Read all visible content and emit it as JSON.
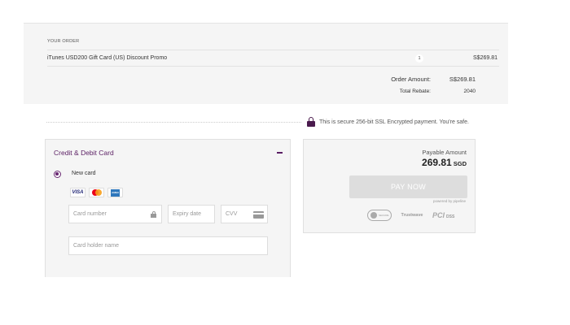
{
  "order": {
    "heading": "YOUR ORDER",
    "item_name": "iTunes USD200 Gift Card (US) Discount Promo",
    "item_qty": "1",
    "item_price": "S$269.81",
    "order_amount_label": "Order Amount:",
    "order_amount_value": "S$269.81",
    "rebate_label": "Total Rebate:",
    "rebate_value": "2040"
  },
  "secure": {
    "text": "This is secure 256-bit SSL Encrypted payment. You're safe."
  },
  "card_form": {
    "title": "Credit & Debit Card",
    "new_card_label": "New card",
    "brands": [
      "VISA",
      "mastercard",
      "AMEX"
    ],
    "card_number_placeholder": "Card number",
    "expiry_placeholder": "Expiry date",
    "cvv_placeholder": "CVV",
    "holder_placeholder": "Card holder name"
  },
  "payment": {
    "payable_label": "Payable Amount",
    "amount": "269.81",
    "currency": "SGD",
    "pay_button": "PAY NOW",
    "powered_by": "powered by pipeline",
    "badge_secure": "SECURE",
    "badge_trustwave": "Trustwave",
    "badge_pci": "PCI",
    "badge_pci_sub": "DSS"
  },
  "colors": {
    "accent": "#5a1e63",
    "panel_bg": "#f5f5f5",
    "button_disabled": "#dddddd"
  }
}
